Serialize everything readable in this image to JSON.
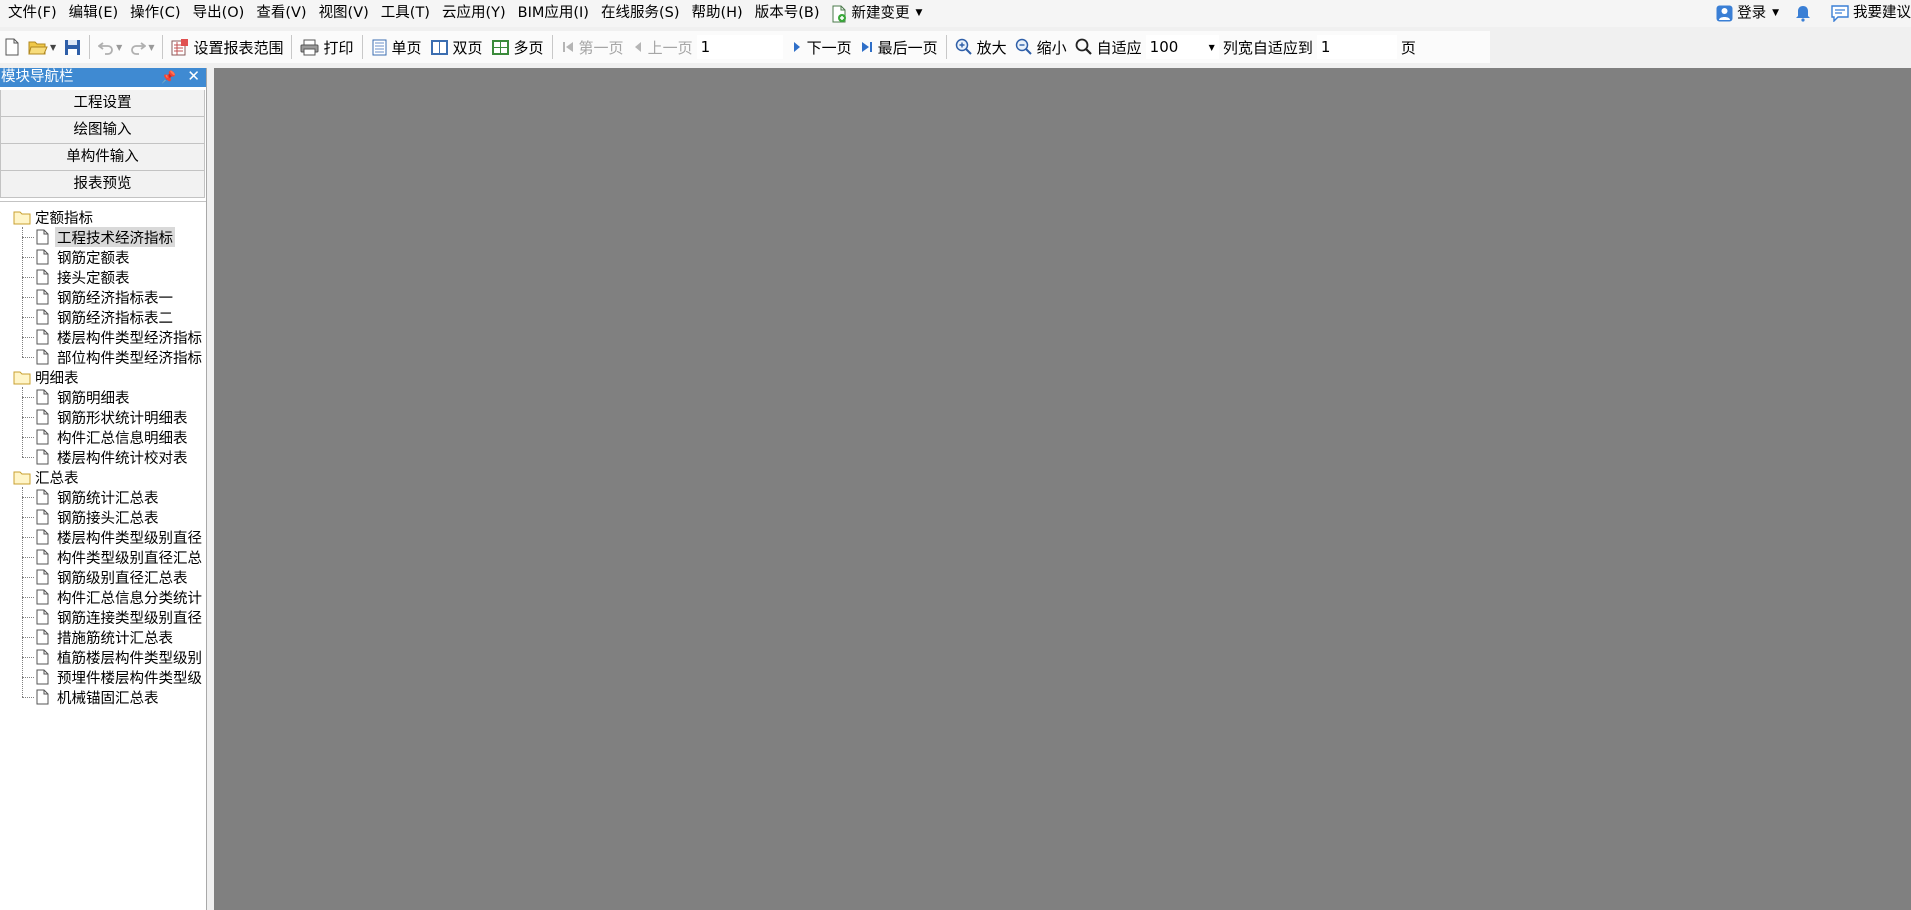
{
  "menu": {
    "items": [
      "文件(F)",
      "编辑(E)",
      "操作(C)",
      "导出(O)",
      "查看(V)",
      "视图(V)",
      "工具(T)",
      "云应用(Y)",
      "BIM应用(I)",
      "在线服务(S)",
      "帮助(H)",
      "版本号(B)"
    ],
    "new_change": "新建变更",
    "login": "登录",
    "suggest": "我要建议"
  },
  "toolbar": {
    "set_range": "设置报表范围",
    "print": "打印",
    "single_page": "单页",
    "double_page": "双页",
    "multi_page": "多页",
    "first_page": "第一页",
    "prev_page": "上一页",
    "page_value": "1",
    "next_page": "下一页",
    "last_page": "最后一页",
    "zoom_in": "放大",
    "zoom_out": "缩小",
    "fit": "自适应",
    "zoom_value": "100",
    "col_fit": "列宽自适应到",
    "col_fit_value": "1",
    "page_unit": "页"
  },
  "nav": {
    "title": "模块导航栏",
    "buttons": [
      "工程设置",
      "绘图输入",
      "单构件输入",
      "报表预览"
    ],
    "groups": [
      {
        "label": "定额指标",
        "items": [
          "工程技术经济指标",
          "钢筋定额表",
          "接头定额表",
          "钢筋经济指标表一",
          "钢筋经济指标表二",
          "楼层构件类型经济指标",
          "部位构件类型经济指标"
        ]
      },
      {
        "label": "明细表",
        "items": [
          "钢筋明细表",
          "钢筋形状统计明细表",
          "构件汇总信息明细表",
          "楼层构件统计校对表"
        ]
      },
      {
        "label": "汇总表",
        "items": [
          "钢筋统计汇总表",
          "钢筋接头汇总表",
          "楼层构件类型级别直径",
          "构件类型级别直径汇总",
          "钢筋级别直径汇总表",
          "构件汇总信息分类统计",
          "钢筋连接类型级别直径",
          "措施筋统计汇总表",
          "植筋楼层构件类型级别",
          "预埋件楼层构件类型级",
          "机械锚固汇总表"
        ]
      }
    ]
  }
}
